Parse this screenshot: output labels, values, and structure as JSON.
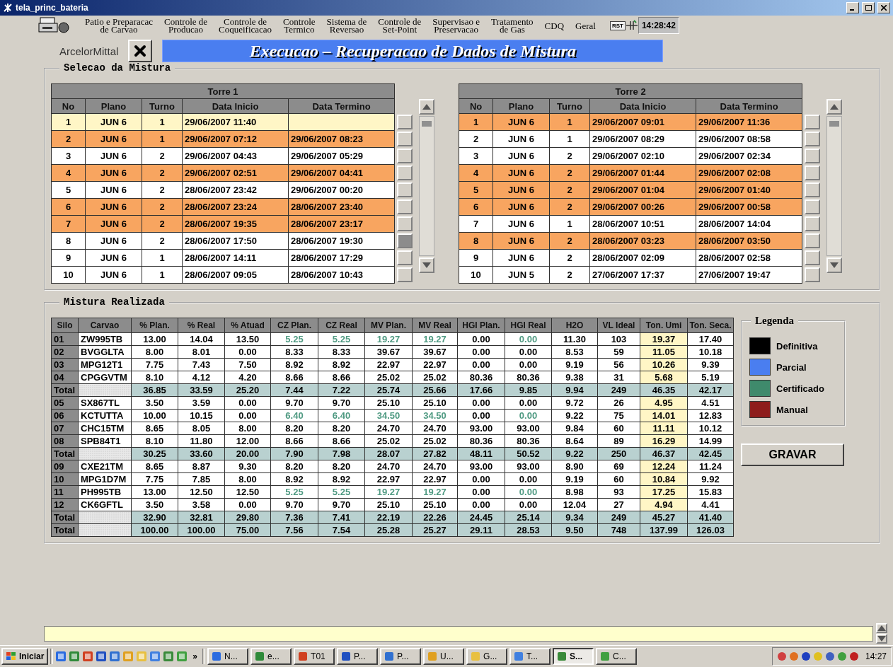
{
  "window": {
    "title": "tela_princ_bateria"
  },
  "menu": [
    {
      "lines": [
        "Patio e Preparacac",
        "de Carvao"
      ]
    },
    {
      "lines": [
        "Controle de",
        "Producao"
      ]
    },
    {
      "lines": [
        "Controle de",
        "Coqueificacao"
      ]
    },
    {
      "lines": [
        "Controle",
        "Termico"
      ]
    },
    {
      "lines": [
        "Sistema de",
        "Reversao"
      ]
    },
    {
      "lines": [
        "Controle de",
        "Set-Point"
      ]
    },
    {
      "lines": [
        "Supervisao e",
        "Preservacao"
      ]
    },
    {
      "lines": [
        "Tratamento",
        "de Gas"
      ]
    },
    {
      "lines": [
        "CDQ"
      ]
    },
    {
      "lines": [
        "Geral"
      ]
    }
  ],
  "rst": "RST",
  "clock": "14:28:42",
  "brand": "ArcelorMittal",
  "banner": "Execucao – Recuperacao de Dados de Mistura",
  "selection": {
    "title": "Selecao da Mistura",
    "towers": [
      {
        "title": "Torre 1",
        "columns": [
          "No",
          "Plano",
          "Turno",
          "Data Inicio",
          "Data Termino"
        ],
        "rows": [
          {
            "current": true,
            "highlighted": false,
            "selected": false,
            "cells": [
              "1",
              "JUN 6",
              "1",
              "29/06/2007 11:40",
              ""
            ]
          },
          {
            "current": false,
            "highlighted": true,
            "selected": false,
            "cells": [
              "2",
              "JUN 6",
              "1",
              "29/06/2007 07:12",
              "29/06/2007 08:23"
            ]
          },
          {
            "current": false,
            "highlighted": false,
            "selected": false,
            "cells": [
              "3",
              "JUN 6",
              "2",
              "29/06/2007 04:43",
              "29/06/2007 05:29"
            ]
          },
          {
            "current": false,
            "highlighted": true,
            "selected": false,
            "cells": [
              "4",
              "JUN 6",
              "2",
              "29/06/2007 02:51",
              "29/06/2007 04:41"
            ]
          },
          {
            "current": false,
            "highlighted": false,
            "selected": false,
            "cells": [
              "5",
              "JUN 6",
              "2",
              "28/06/2007 23:42",
              "29/06/2007 00:20"
            ]
          },
          {
            "current": false,
            "highlighted": true,
            "selected": false,
            "cells": [
              "6",
              "JUN 6",
              "2",
              "28/06/2007 23:24",
              "28/06/2007 23:40"
            ]
          },
          {
            "current": false,
            "highlighted": true,
            "selected": false,
            "cells": [
              "7",
              "JUN 6",
              "2",
              "28/06/2007 19:35",
              "28/06/2007 23:17"
            ]
          },
          {
            "current": false,
            "highlighted": false,
            "selected": true,
            "cells": [
              "8",
              "JUN 6",
              "2",
              "28/06/2007 17:50",
              "28/06/2007 19:30"
            ]
          },
          {
            "current": false,
            "highlighted": false,
            "selected": false,
            "cells": [
              "9",
              "JUN 6",
              "1",
              "28/06/2007 14:11",
              "28/06/2007 17:29"
            ]
          },
          {
            "current": false,
            "highlighted": false,
            "selected": false,
            "cells": [
              "10",
              "JUN 6",
              "1",
              "28/06/2007 09:05",
              "28/06/2007 10:43"
            ]
          }
        ]
      },
      {
        "title": "Torre 2",
        "columns": [
          "No",
          "Plano",
          "Turno",
          "Data Inicio",
          "Data Termino"
        ],
        "rows": [
          {
            "current": false,
            "highlighted": true,
            "selected": false,
            "cells": [
              "1",
              "JUN 6",
              "1",
              "29/06/2007 09:01",
              "29/06/2007 11:36"
            ]
          },
          {
            "current": false,
            "highlighted": false,
            "selected": false,
            "cells": [
              "2",
              "JUN 6",
              "1",
              "29/06/2007 08:29",
              "29/06/2007 08:58"
            ]
          },
          {
            "current": false,
            "highlighted": false,
            "selected": false,
            "cells": [
              "3",
              "JUN 6",
              "2",
              "29/06/2007 02:10",
              "29/06/2007 02:34"
            ]
          },
          {
            "current": false,
            "highlighted": true,
            "selected": false,
            "cells": [
              "4",
              "JUN 6",
              "2",
              "29/06/2007 01:44",
              "29/06/2007 02:08"
            ]
          },
          {
            "current": false,
            "highlighted": true,
            "selected": false,
            "cells": [
              "5",
              "JUN 6",
              "2",
              "29/06/2007 01:04",
              "29/06/2007 01:40"
            ]
          },
          {
            "current": false,
            "highlighted": true,
            "selected": false,
            "cells": [
              "6",
              "JUN 6",
              "2",
              "29/06/2007 00:26",
              "29/06/2007 00:58"
            ]
          },
          {
            "current": false,
            "highlighted": false,
            "selected": false,
            "cells": [
              "7",
              "JUN 6",
              "1",
              "28/06/2007 10:51",
              "28/06/2007 14:04"
            ]
          },
          {
            "current": false,
            "highlighted": true,
            "selected": false,
            "cells": [
              "8",
              "JUN 6",
              "2",
              "28/06/2007 03:23",
              "28/06/2007 03:50"
            ]
          },
          {
            "current": false,
            "highlighted": false,
            "selected": false,
            "cells": [
              "9",
              "JUN 6",
              "2",
              "28/06/2007 02:09",
              "28/06/2007 02:58"
            ]
          },
          {
            "current": false,
            "highlighted": false,
            "selected": false,
            "cells": [
              "10",
              "JUN 5",
              "2",
              "27/06/2007 17:37",
              "27/06/2007 19:47"
            ]
          }
        ]
      }
    ]
  },
  "mix": {
    "title": "Mistura Realizada",
    "columns": [
      "Silo",
      "Carvao",
      "% Plan.",
      "% Real",
      "% Atuad",
      "CZ Plan.",
      "CZ Real",
      "MV Plan.",
      "MV Real",
      "HGI Plan.",
      "HGI Real",
      "H2O",
      "VL Ideal",
      "Ton. Umi",
      "Ton. Seca."
    ],
    "rows": [
      {
        "kind": "silo",
        "certified": true,
        "cells": [
          "01",
          "ZW995TB",
          "13.00",
          "14.04",
          "13.50",
          "5.25",
          "5.25",
          "19.27",
          "19.27",
          "0.00",
          "0.00",
          "11.30",
          "103",
          "19.37",
          "17.40"
        ]
      },
      {
        "kind": "silo",
        "certified": false,
        "cells": [
          "02",
          "BVGGLTA",
          "8.00",
          "8.01",
          "0.00",
          "8.33",
          "8.33",
          "39.67",
          "39.67",
          "0.00",
          "0.00",
          "8.53",
          "59",
          "11.05",
          "10.18"
        ]
      },
      {
        "kind": "silo",
        "certified": false,
        "cells": [
          "03",
          "MPG12T1",
          "7.75",
          "7.43",
          "7.50",
          "8.92",
          "8.92",
          "22.97",
          "22.97",
          "0.00",
          "0.00",
          "9.19",
          "56",
          "10.26",
          "9.39"
        ]
      },
      {
        "kind": "silo",
        "certified": false,
        "cells": [
          "04",
          "CPGGVTM",
          "8.10",
          "4.12",
          "4.20",
          "8.66",
          "8.66",
          "25.02",
          "25.02",
          "80.36",
          "80.36",
          "9.38",
          "31",
          "5.68",
          "5.19"
        ]
      },
      {
        "kind": "total",
        "certified": false,
        "cells": [
          "Total",
          "",
          "36.85",
          "33.59",
          "25.20",
          "7.44",
          "7.22",
          "25.74",
          "25.66",
          "17.66",
          "9.85",
          "9.94",
          "249",
          "46.35",
          "42.17"
        ]
      },
      {
        "kind": "silo",
        "certified": false,
        "cells": [
          "05",
          "SX867TL",
          "3.50",
          "3.59",
          "0.00",
          "9.70",
          "9.70",
          "25.10",
          "25.10",
          "0.00",
          "0.00",
          "9.72",
          "26",
          "4.95",
          "4.51"
        ]
      },
      {
        "kind": "silo",
        "certified": true,
        "cells": [
          "06",
          "KCTUTTA",
          "10.00",
          "10.15",
          "0.00",
          "6.40",
          "6.40",
          "34.50",
          "34.50",
          "0.00",
          "0.00",
          "9.22",
          "75",
          "14.01",
          "12.83"
        ]
      },
      {
        "kind": "silo",
        "certified": false,
        "cells": [
          "07",
          "CHC15TM",
          "8.65",
          "8.05",
          "8.00",
          "8.20",
          "8.20",
          "24.70",
          "24.70",
          "93.00",
          "93.00",
          "9.84",
          "60",
          "11.11",
          "10.12"
        ]
      },
      {
        "kind": "silo",
        "certified": false,
        "cells": [
          "08",
          "SPB84T1",
          "8.10",
          "11.80",
          "12.00",
          "8.66",
          "8.66",
          "25.02",
          "25.02",
          "80.36",
          "80.36",
          "8.64",
          "89",
          "16.29",
          "14.99"
        ]
      },
      {
        "kind": "total",
        "certified": false,
        "cells": [
          "Total",
          "",
          "30.25",
          "33.60",
          "20.00",
          "7.90",
          "7.98",
          "28.07",
          "27.82",
          "48.11",
          "50.52",
          "9.22",
          "250",
          "46.37",
          "42.45"
        ]
      },
      {
        "kind": "silo",
        "certified": false,
        "cells": [
          "09",
          "CXE21TM",
          "8.65",
          "8.87",
          "9.30",
          "8.20",
          "8.20",
          "24.70",
          "24.70",
          "93.00",
          "93.00",
          "8.90",
          "69",
          "12.24",
          "11.24"
        ]
      },
      {
        "kind": "silo",
        "certified": false,
        "cells": [
          "10",
          "MPG1D7M",
          "7.75",
          "7.85",
          "8.00",
          "8.92",
          "8.92",
          "22.97",
          "22.97",
          "0.00",
          "0.00",
          "9.19",
          "60",
          "10.84",
          "9.92"
        ]
      },
      {
        "kind": "silo",
        "certified": true,
        "cells": [
          "11",
          "PH995TB",
          "13.00",
          "12.50",
          "12.50",
          "5.25",
          "5.25",
          "19.27",
          "19.27",
          "0.00",
          "0.00",
          "8.98",
          "93",
          "17.25",
          "15.83"
        ]
      },
      {
        "kind": "silo",
        "certified": false,
        "cells": [
          "12",
          "CK6GFTL",
          "3.50",
          "3.58",
          "0.00",
          "9.70",
          "9.70",
          "25.10",
          "25.10",
          "0.00",
          "0.00",
          "12.04",
          "27",
          "4.94",
          "4.41"
        ]
      },
      {
        "kind": "total",
        "certified": false,
        "cells": [
          "Total",
          "",
          "32.90",
          "32.81",
          "29.80",
          "7.36",
          "7.41",
          "22.19",
          "22.26",
          "24.45",
          "25.14",
          "9.34",
          "249",
          "45.27",
          "41.40"
        ]
      },
      {
        "kind": "total",
        "certified": false,
        "cells": [
          "Total",
          "",
          "100.00",
          "100.00",
          "75.00",
          "7.56",
          "7.54",
          "25.28",
          "25.27",
          "29.11",
          "28.53",
          "9.50",
          "748",
          "137.99",
          "126.03"
        ]
      }
    ]
  },
  "legend": {
    "title": "Legenda",
    "items": [
      {
        "label": "Definitiva",
        "color": "#000000"
      },
      {
        "label": "Parcial",
        "color": "#4a7ef0"
      },
      {
        "label": "Certificado",
        "color": "#3f8a6c"
      },
      {
        "label": "Manual",
        "color": "#8e1c1c"
      }
    ]
  },
  "save_button": "GRAVAR",
  "taskbar": {
    "start": "Iniciar",
    "more": "»",
    "tasks": [
      {
        "label": "N...",
        "selected": false
      },
      {
        "label": "e...",
        "selected": false
      },
      {
        "label": "T01",
        "selected": false
      },
      {
        "label": "P...",
        "selected": false
      },
      {
        "label": "P...",
        "selected": false
      },
      {
        "label": "U...",
        "selected": false
      },
      {
        "label": "G...",
        "selected": false
      },
      {
        "label": "T...",
        "selected": false
      },
      {
        "label": "S...",
        "selected": true
      },
      {
        "label": "C...",
        "selected": false
      }
    ],
    "time": "14:27"
  }
}
